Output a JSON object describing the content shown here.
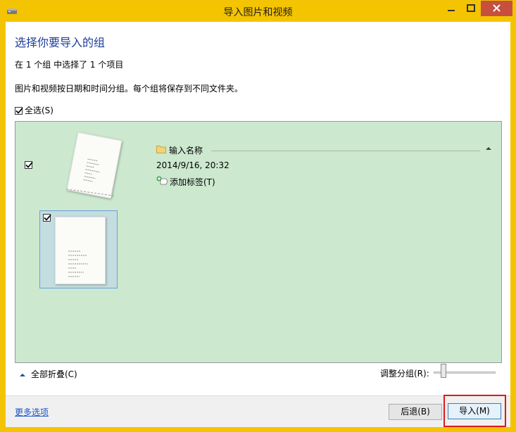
{
  "window": {
    "title": "导入图片和视频",
    "accent_color": "#f5c400",
    "close_button_color": "#c74f3e",
    "icons": [
      "scanner-app-icon",
      "minimize-icon",
      "maximize-icon",
      "close-icon"
    ]
  },
  "page": {
    "heading": "选择你要导入的组",
    "selection_summary": "在 1 个组 中选择了 1 个项目",
    "description": "图片和视频按日期和时间分组。每个组将保存到不同文件夹。",
    "select_all_label": "全选(S)",
    "select_all_checked": true
  },
  "group": {
    "checked": true,
    "name_placeholder": "输入名称",
    "date_time": "2014/9/16, 20:32",
    "add_tag_label": "添加标签(T)",
    "items": [
      {
        "checked": true,
        "selected": true
      }
    ],
    "background_color": "#cce8cf"
  },
  "controls": {
    "collapse_all_label": "全部折叠(C)",
    "adjust_groups_label": "调整分组(R):",
    "adjust_groups_level": 0.12
  },
  "footer": {
    "more_options_label": "更多选项",
    "back_button_label": "后退(B)",
    "import_button_label": "导入(M)",
    "highlight_color": "#e0191b"
  }
}
